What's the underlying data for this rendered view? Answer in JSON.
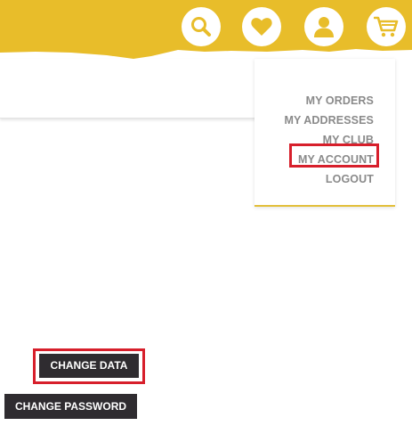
{
  "header": {
    "accent_color": "#e8bd2a",
    "icons": [
      {
        "name": "search-icon"
      },
      {
        "name": "heart-icon"
      },
      {
        "name": "user-icon"
      },
      {
        "name": "cart-icon"
      }
    ]
  },
  "account_menu": {
    "items": [
      {
        "label": "MY ORDERS"
      },
      {
        "label": "MY ADDRESSES"
      },
      {
        "label": "MY CLUB"
      },
      {
        "label": "MY ACCOUNT",
        "highlighted": true
      },
      {
        "label": "LOGOUT"
      }
    ],
    "highlight_color": "#d71f2b"
  },
  "actions": {
    "change_data_label": "CHANGE DATA",
    "change_password_label": "CHANGE PASSWORD",
    "button_color": "#2f2c30"
  }
}
